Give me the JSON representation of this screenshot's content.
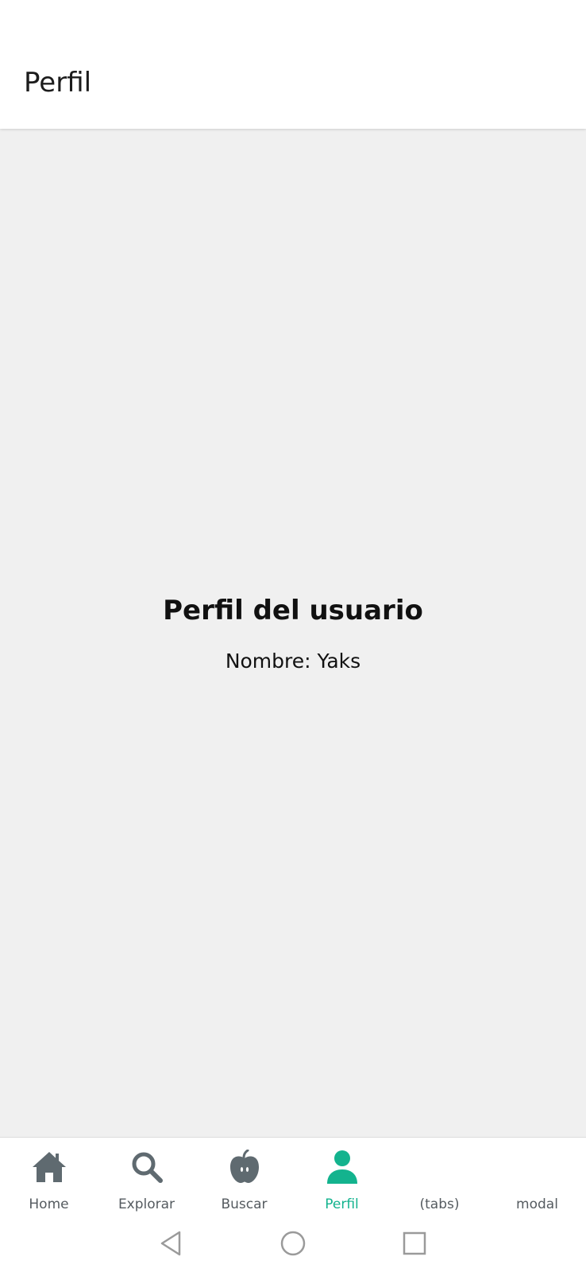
{
  "header": {
    "title": "Perfil"
  },
  "profile": {
    "heading": "Perfil del usuario",
    "name_line": "Nombre: Yaks"
  },
  "tabs": [
    {
      "label": "Home",
      "icon": "home-icon",
      "active": false
    },
    {
      "label": "Explorar",
      "icon": "search-icon",
      "active": false
    },
    {
      "label": "Buscar",
      "icon": "apple-icon",
      "active": false
    },
    {
      "label": "Perfil",
      "icon": "user-icon",
      "active": true
    },
    {
      "label": "(tabs)",
      "icon": "",
      "active": false
    },
    {
      "label": "modal",
      "icon": "",
      "active": false
    }
  ],
  "colors": {
    "accent": "#13b38e",
    "inactive_icon": "#5f6a70",
    "inactive_label": "#555b60",
    "background": "#f0f0f0",
    "header_bg": "#ffffff"
  },
  "system_nav": {
    "back": "back-icon",
    "home": "home-circle-icon",
    "recents": "recents-icon"
  }
}
